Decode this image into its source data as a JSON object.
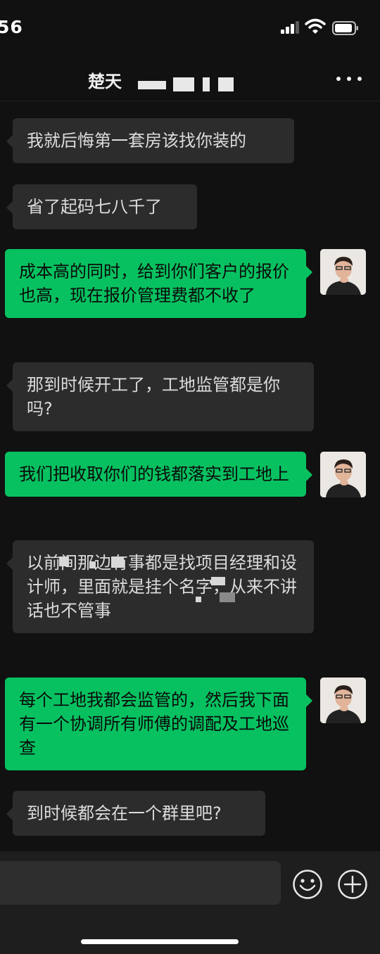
{
  "status": {
    "time": "56"
  },
  "header": {
    "title": "楚天"
  },
  "messages": [
    {
      "side": "in",
      "text": "我就后悔第一套房该找你装的"
    },
    {
      "side": "in",
      "text": "省了起码七八千了"
    },
    {
      "side": "out",
      "text": "成本高的同时，给到你们客户的报价也高，现在报价管理费都不收了"
    },
    {
      "side": "in",
      "text": "那到时候开工了，工地监管都是你吗?"
    },
    {
      "side": "out",
      "text": "我们把收取你们的钱都落实到工地上"
    },
    {
      "side": "in",
      "text": "以前间那边有事都是找项目经理和设计师，里面就是挂个名字，从来不讲话也不管事"
    },
    {
      "side": "out",
      "text": "每个工地我都会监管的，然后我下面有一个协调所有师傅的调配及工地巡查"
    },
    {
      "side": "in",
      "text": "到时候都会在一个群里吧?"
    }
  ],
  "input": {
    "placeholder": ""
  },
  "icons": {
    "more": "more-icon",
    "emoji": "emoji-icon",
    "plus": "plus-icon",
    "wifi": "wifi-icon",
    "battery": "battery-icon",
    "signal": "signal-icon"
  },
  "colors": {
    "outgoing": "#07c160",
    "incoming": "#2c2c2c",
    "background": "#111111"
  }
}
